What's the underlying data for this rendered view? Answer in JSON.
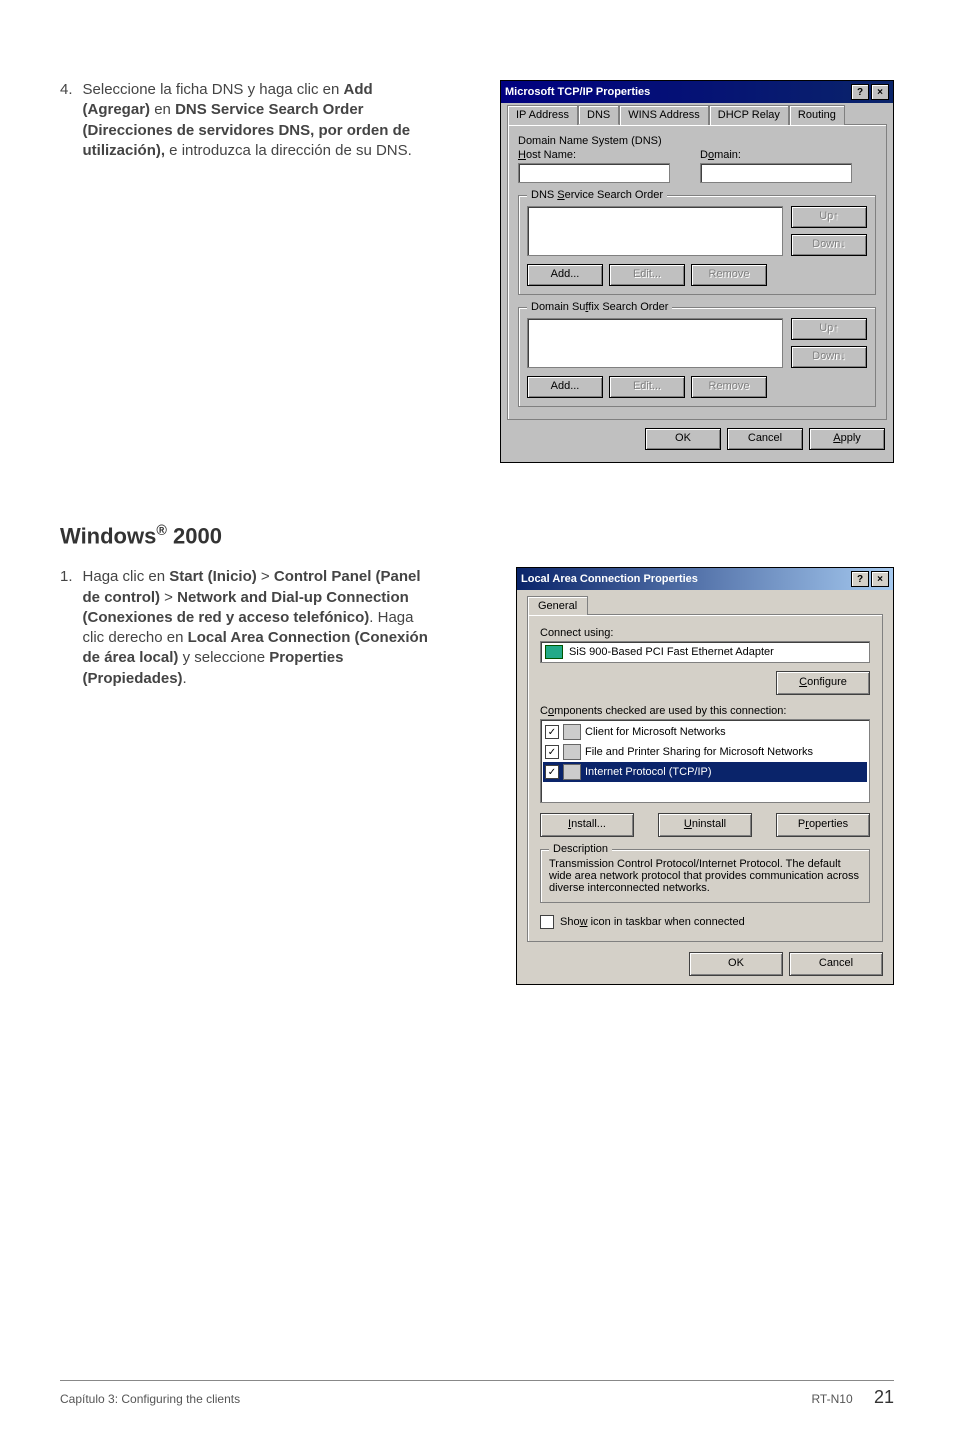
{
  "doc": {
    "item4": {
      "num": "4.",
      "text_a": "Seleccione la ficha DNS y haga clic en ",
      "b1": "Add (Agregar)",
      "text_b": " en ",
      "b2": "DNS Service Search Order (Direcciones de servidores DNS, por orden de utilización),",
      "text_c": " e introduzca la dirección de su DNS."
    },
    "heading_a": "Windows",
    "heading_sup": "®",
    "heading_b": " 2000",
    "item1": {
      "num": "1.",
      "text_a": "Haga clic en ",
      "b1": "Start (Inicio)",
      "gt1": " > ",
      "b2": "Control Panel (Panel de control)",
      "gt2": " > ",
      "b3": "Network and Dial-up Connection (Conexiones de red y acceso telefónico)",
      "text_b": ". Haga clic derecho en ",
      "b4": "Local Area Connection (Conexión de área local)",
      "text_c": " y seleccione ",
      "b5": "Properties (Propiedades)",
      "text_d": "."
    },
    "footer_left": "Capítulo 3: Configuring the clients",
    "footer_model": "RT-N10",
    "footer_page": "21"
  },
  "dlg1": {
    "title": "Microsoft TCP/IP Properties",
    "help": "?",
    "close": "×",
    "tabs": {
      "t0": "IP Address",
      "t1": "DNS",
      "t2": "WINS Address",
      "t3": "DHCP Relay",
      "t4": "Routing"
    },
    "dns_sys": "Domain Name System (DNS)",
    "host": "Host Name:",
    "domain": "Domain:",
    "grp1": "DNS Service Search Order",
    "grp2": "Domain Suffix Search Order",
    "up": "Up↑",
    "down": "Down↓",
    "add": "Add...",
    "edit": "Edit...",
    "remove": "Remove",
    "ok": "OK",
    "cancel": "Cancel",
    "apply": "Apply"
  },
  "dlg2": {
    "title": "Local Area Connection Properties",
    "help": "?",
    "close": "×",
    "tab": "General",
    "connect_using": "Connect using:",
    "adapter": "SiS 900-Based PCI Fast Ethernet Adapter",
    "configure": "Configure",
    "components_label": "Components checked are used by this connection:",
    "c1": "Client for Microsoft Networks",
    "c2": "File and Printer Sharing for Microsoft Networks",
    "c3": "Internet Protocol (TCP/IP)",
    "install": "Install...",
    "uninstall": "Uninstall",
    "properties": "Properties",
    "desc_legend": "Description",
    "desc_text": "Transmission Control Protocol/Internet Protocol. The default wide area network protocol that provides communication across diverse interconnected networks.",
    "show_icon": "Show icon in taskbar when connected",
    "ok": "OK",
    "cancel": "Cancel"
  }
}
